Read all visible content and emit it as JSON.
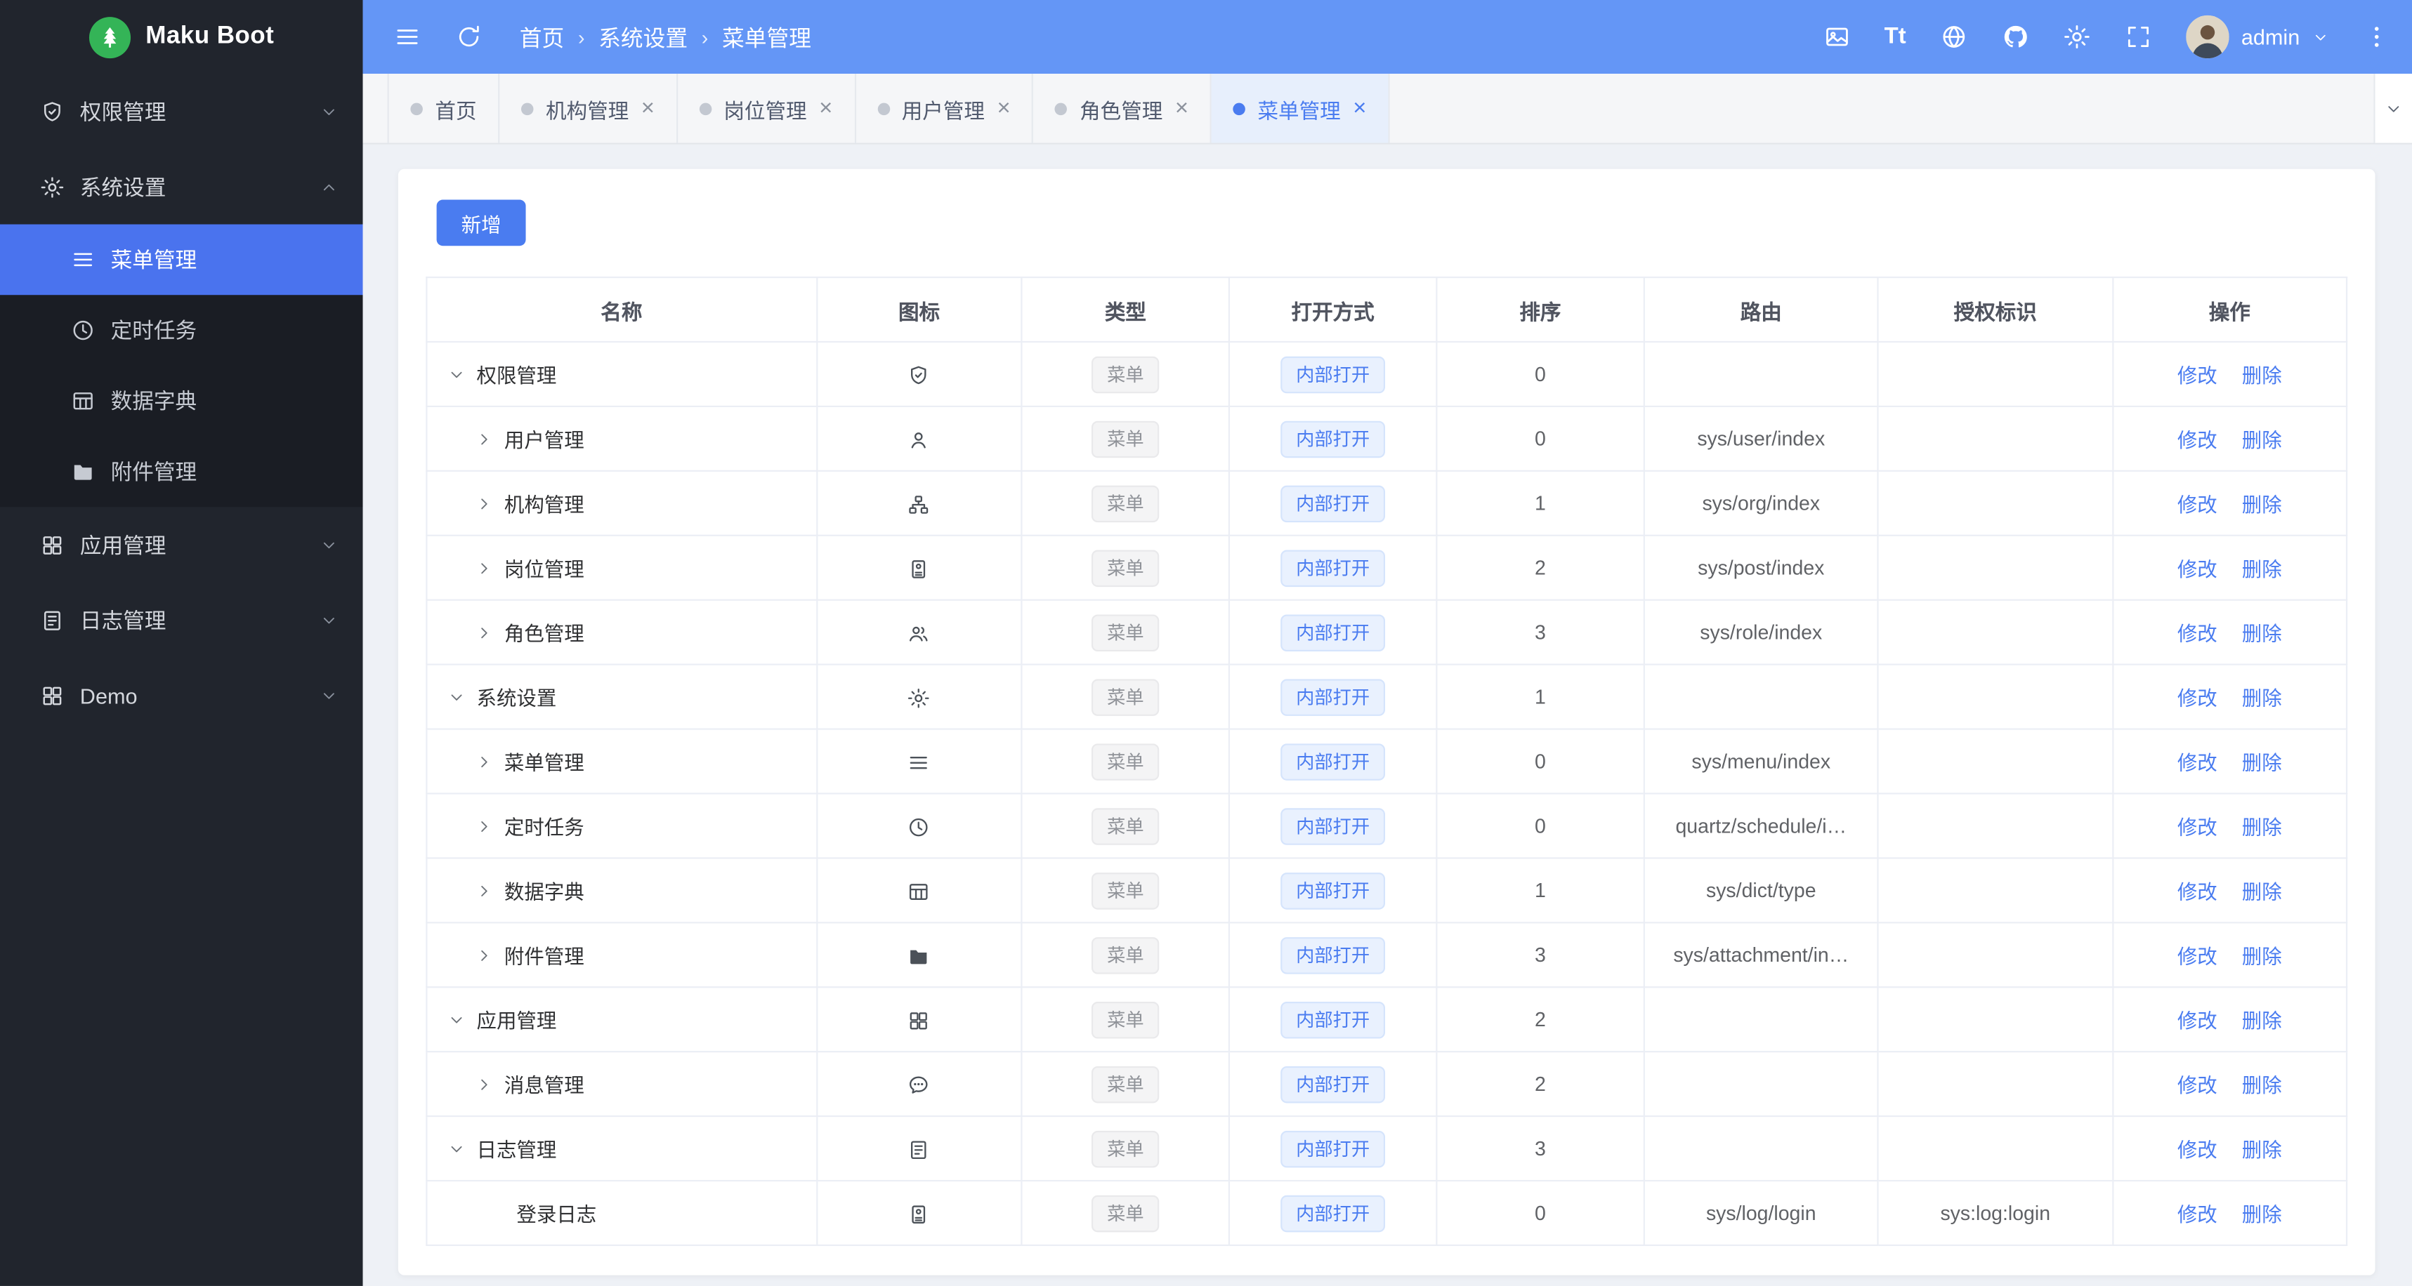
{
  "app": {
    "name": "Maku Boot"
  },
  "colors": {
    "primary": "#4a7cf0",
    "header_blue": "#6496f6",
    "sidebar_bg": "#21252d",
    "sidebar_active": "#4a73ee",
    "content_bg": "#eef1f6",
    "tag_gray_text": "#909399",
    "logo_green": "#34b457"
  },
  "header": {
    "breadcrumb": [
      "首页",
      "系统设置",
      "菜单管理"
    ],
    "breadcrumb_sep": "›",
    "font_size_glyph": "Tt",
    "user": "admin",
    "tool_icons": [
      "image-icon",
      "font-size-icon",
      "globe-icon",
      "github-icon",
      "gear-icon",
      "fullscreen-icon",
      "more-vertical-icon"
    ]
  },
  "tabs": {
    "close_glyph": "×",
    "items": [
      {
        "label": "首页",
        "closable": false,
        "active": false
      },
      {
        "label": "机构管理",
        "closable": true,
        "active": false
      },
      {
        "label": "岗位管理",
        "closable": true,
        "active": false
      },
      {
        "label": "用户管理",
        "closable": true,
        "active": false
      },
      {
        "label": "角色管理",
        "closable": true,
        "active": false
      },
      {
        "label": "菜单管理",
        "closable": true,
        "active": true
      }
    ]
  },
  "sidebar": {
    "items": [
      {
        "label": "权限管理",
        "icon": "shield-icon",
        "expanded": false
      },
      {
        "label": "系统设置",
        "icon": "gear-icon",
        "expanded": true,
        "children": [
          {
            "label": "菜单管理",
            "icon": "menu-lines-icon",
            "active": true
          },
          {
            "label": "定时任务",
            "icon": "clock-icon",
            "active": false
          },
          {
            "label": "数据字典",
            "icon": "table-grid-icon",
            "active": false
          },
          {
            "label": "附件管理",
            "icon": "folder-icon",
            "active": false
          }
        ]
      },
      {
        "label": "应用管理",
        "icon": "apps-grid-icon",
        "expanded": false
      },
      {
        "label": "日志管理",
        "icon": "log-file-icon",
        "expanded": false
      },
      {
        "label": "Demo",
        "icon": "apps-grid-icon",
        "expanded": false
      }
    ]
  },
  "toolbar": {
    "add_label": "新增"
  },
  "table": {
    "headers": [
      "名称",
      "图标",
      "类型",
      "打开方式",
      "排序",
      "路由",
      "授权标识",
      "操作"
    ],
    "edit_label": "修改",
    "delete_label": "删除",
    "rows": [
      {
        "name": "权限管理",
        "icon": "shield-check-icon",
        "state": "expanded",
        "type": "菜单",
        "open_mode": "内部打开",
        "sort": "0",
        "route": "",
        "auth": ""
      },
      {
        "name": "用户管理",
        "icon": "user-icon",
        "state": "child",
        "type": "菜单",
        "open_mode": "内部打开",
        "sort": "0",
        "route": "sys/user/index",
        "auth": ""
      },
      {
        "name": "机构管理",
        "icon": "org-icon",
        "state": "child",
        "type": "菜单",
        "open_mode": "内部打开",
        "sort": "1",
        "route": "sys/org/index",
        "auth": ""
      },
      {
        "name": "岗位管理",
        "icon": "badge-icon",
        "state": "child",
        "type": "菜单",
        "open_mode": "内部打开",
        "sort": "2",
        "route": "sys/post/index",
        "auth": ""
      },
      {
        "name": "角色管理",
        "icon": "users-icon",
        "state": "child",
        "type": "菜单",
        "open_mode": "内部打开",
        "sort": "3",
        "route": "sys/role/index",
        "auth": ""
      },
      {
        "name": "系统设置",
        "icon": "gear-icon",
        "state": "expanded",
        "type": "菜单",
        "open_mode": "内部打开",
        "sort": "1",
        "route": "",
        "auth": ""
      },
      {
        "name": "菜单管理",
        "icon": "menu-lines-icon",
        "state": "child",
        "type": "菜单",
        "open_mode": "内部打开",
        "sort": "0",
        "route": "sys/menu/index",
        "auth": ""
      },
      {
        "name": "定时任务",
        "icon": "clock-icon",
        "state": "child",
        "type": "菜单",
        "open_mode": "内部打开",
        "sort": "0",
        "route": "quartz/schedule/i…",
        "auth": ""
      },
      {
        "name": "数据字典",
        "icon": "table-grid-icon",
        "state": "child",
        "type": "菜单",
        "open_mode": "内部打开",
        "sort": "1",
        "route": "sys/dict/type",
        "auth": ""
      },
      {
        "name": "附件管理",
        "icon": "folder-icon",
        "state": "child",
        "type": "菜单",
        "open_mode": "内部打开",
        "sort": "3",
        "route": "sys/attachment/in…",
        "auth": ""
      },
      {
        "name": "应用管理",
        "icon": "apps-grid-icon",
        "state": "expanded",
        "type": "菜单",
        "open_mode": "内部打开",
        "sort": "2",
        "route": "",
        "auth": ""
      },
      {
        "name": "消息管理",
        "icon": "message-icon",
        "state": "child",
        "type": "菜单",
        "open_mode": "内部打开",
        "sort": "2",
        "route": "",
        "auth": ""
      },
      {
        "name": "日志管理",
        "icon": "log-file-icon",
        "state": "expanded",
        "type": "菜单",
        "open_mode": "内部打开",
        "sort": "3",
        "route": "",
        "auth": ""
      },
      {
        "name": "登录日志",
        "icon": "badge-icon",
        "state": "leaf",
        "type": "菜单",
        "open_mode": "内部打开",
        "sort": "0",
        "route": "sys/log/login",
        "auth": "sys:log:login"
      }
    ]
  }
}
